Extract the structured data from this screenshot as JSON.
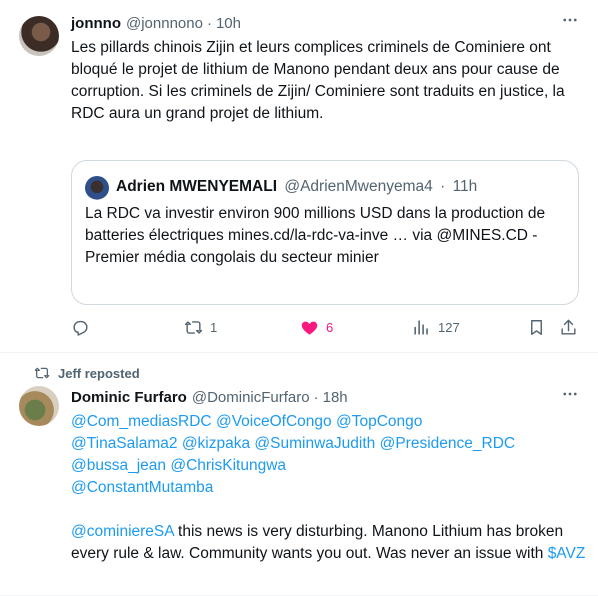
{
  "tweet1": {
    "name": "jonnno",
    "handle": "@jonnnono",
    "time": "10h",
    "text": "Les pillards chinois Zijin et leurs complices criminels de Cominiere ont bloqué le projet de lithium de Manono pendant deux ans pour cause de corruption. Si les criminels de Zijin/ Cominiere sont traduits en justice, la RDC aura un grand projet de lithium.",
    "quote": {
      "name": "Adrien MWENYEMALI",
      "handle": "@AdrienMwenyema4",
      "time": "11h",
      "text": "La RDC va investir environ 900 millions USD dans la production de batteries électriques mines.cd/la-rdc-va-inve … via @MINES.CD - Premier média congolais du secteur minier"
    },
    "actions": {
      "reply_count": "",
      "retweet_count": "1",
      "like_count": "6",
      "view_count": "127"
    }
  },
  "tweet2": {
    "reposted_by": "Jeff reposted",
    "name": "Dominic Furfaro",
    "handle": "@DominicFurfaro",
    "time": "18h",
    "mentions": [
      "@Com_mediasRDC",
      "@VoiceOfCongo",
      "@TopCongo",
      "@TinaSalama2",
      "@kizpaka",
      "@SuminwaJudith",
      "@Presidence_RDC",
      "@bussa_jean",
      "@ChrisKitungwa",
      "@ConstantMutamba"
    ],
    "mention2": "@cominiereSA",
    "text": " this news is very disturbing. Manono Lithium has broken every rule & law. Community wants you out. Was never an issue with ",
    "cashtag": "$AVZ"
  },
  "icons": {
    "more": "more-icon",
    "reply": "reply-icon",
    "retweet": "retweet-icon",
    "like": "heart-icon",
    "views": "views-icon",
    "bookmark": "bookmark-icon",
    "share": "share-icon"
  },
  "colors": {
    "accent": "#1d9bf0",
    "like": "#f91880",
    "muted": "#536471"
  }
}
